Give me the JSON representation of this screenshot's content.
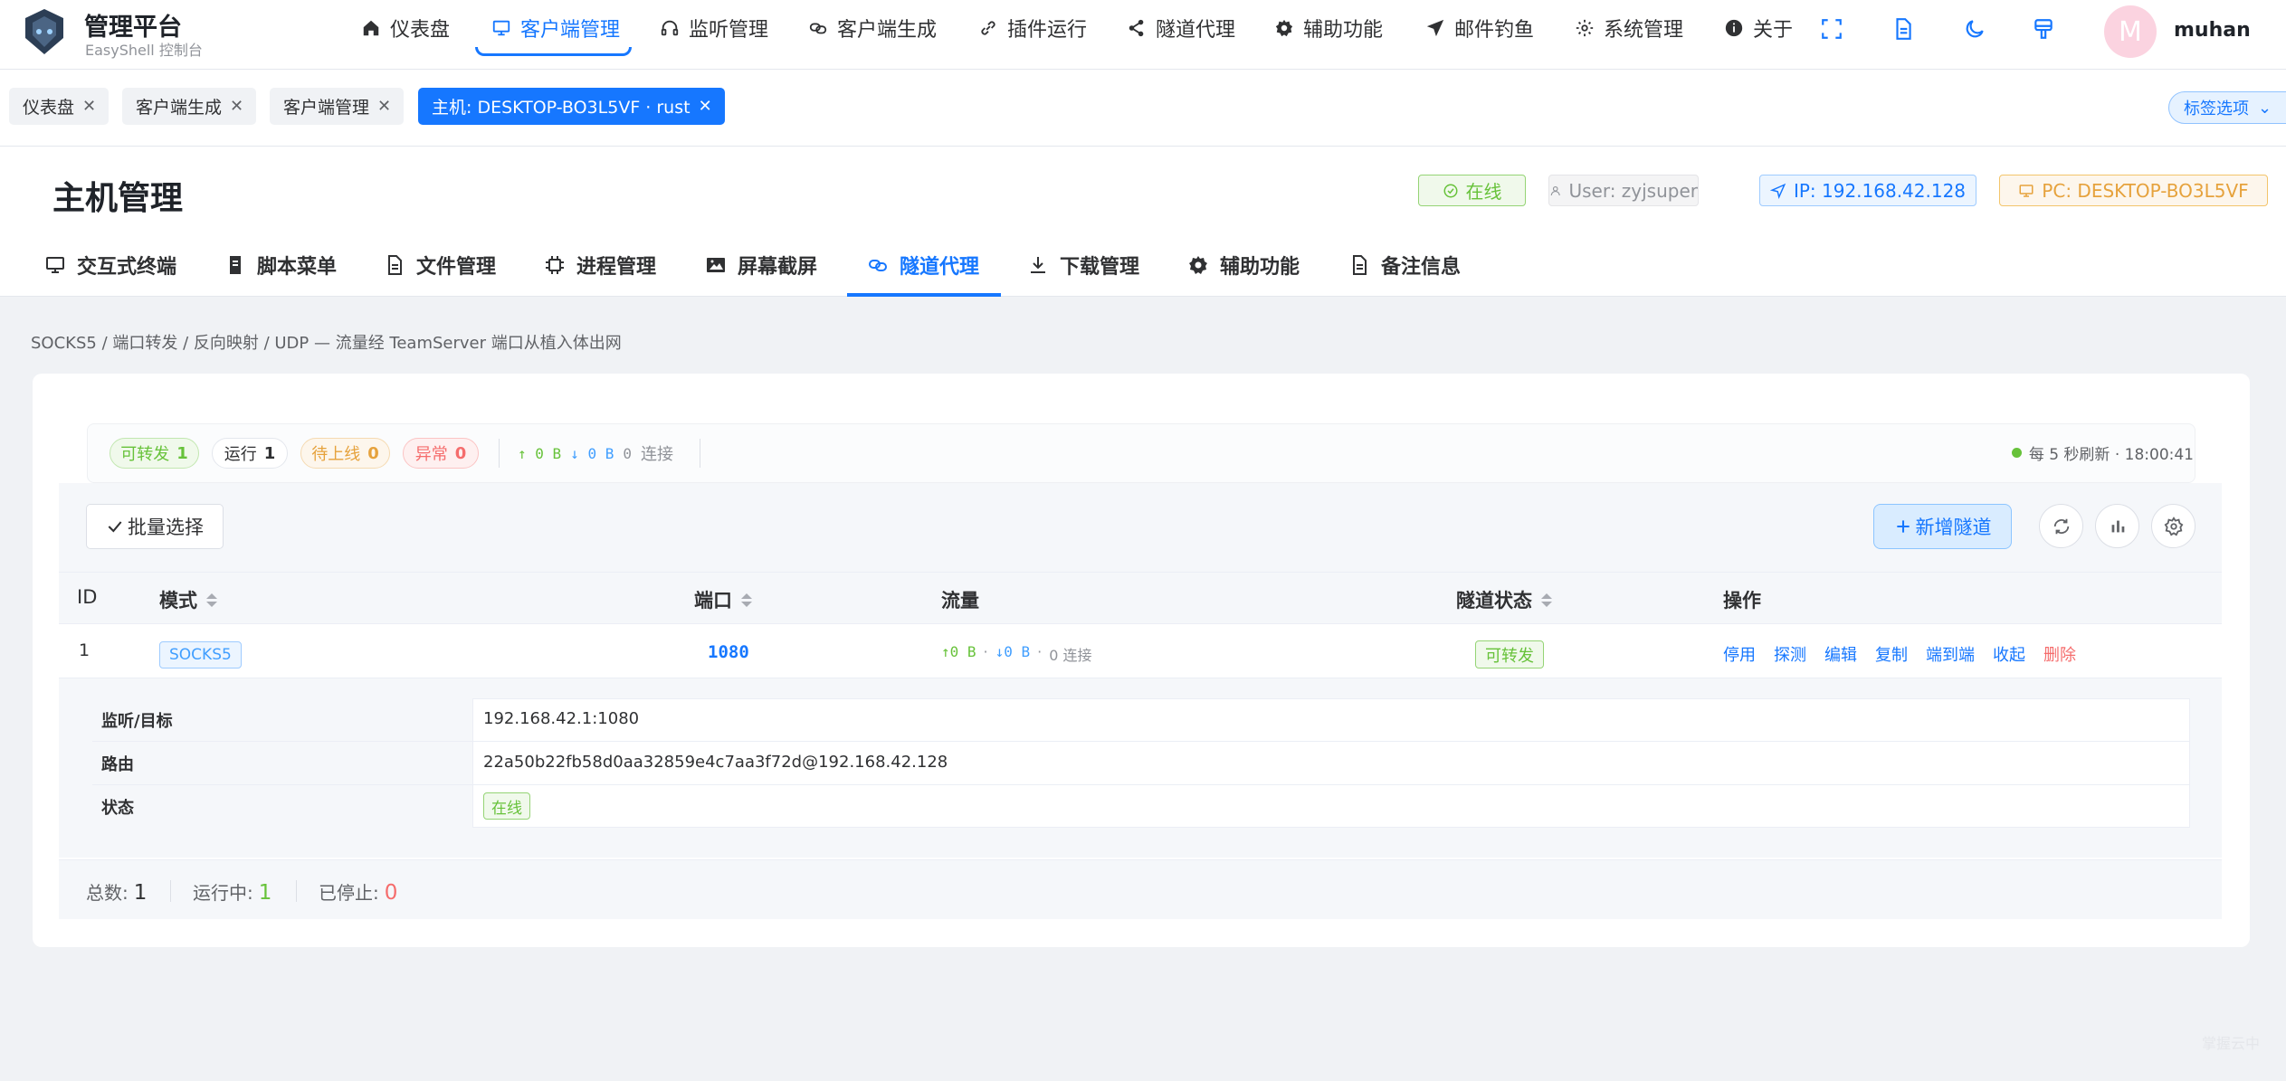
{
  "brand": {
    "title": "管理平台",
    "subtitle": "EasyShell 控制台"
  },
  "nav": [
    {
      "label": "仪表盘",
      "icon": "home-icon"
    },
    {
      "label": "客户端管理",
      "icon": "monitor-icon",
      "active": true
    },
    {
      "label": "监听管理",
      "icon": "headset-icon"
    },
    {
      "label": "客户端生成",
      "icon": "link-chain-icon"
    },
    {
      "label": "插件运行",
      "icon": "link-icon"
    },
    {
      "label": "隧道代理",
      "icon": "share-icon"
    },
    {
      "label": "辅助功能",
      "icon": "gear-icon"
    },
    {
      "label": "邮件钓鱼",
      "icon": "paper-plane-icon"
    },
    {
      "label": "系统管理",
      "icon": "settings-icon"
    },
    {
      "label": "关于",
      "icon": "info-icon"
    }
  ],
  "user": {
    "avatar_letter": "M",
    "name": "muhan"
  },
  "tags": [
    {
      "label": "仪表盘"
    },
    {
      "label": "客户端生成"
    },
    {
      "label": "客户端管理"
    },
    {
      "label": "主机: DESKTOP-BO3L5VF · rust",
      "active": true
    }
  ],
  "tag_options": "标签选项",
  "page": {
    "title": "主机管理",
    "badges": {
      "online": "在线",
      "user": "User: zyjsuper",
      "ip": "IP: 192.168.42.128",
      "pc": "PC: DESKTOP-BO3L5VF"
    }
  },
  "subtabs": [
    {
      "label": "交互式终端",
      "icon": "monitor-icon"
    },
    {
      "label": "脚本菜单",
      "icon": "script-icon"
    },
    {
      "label": "文件管理",
      "icon": "file-icon"
    },
    {
      "label": "进程管理",
      "icon": "cpu-icon"
    },
    {
      "label": "屏幕截屏",
      "icon": "image-icon"
    },
    {
      "label": "隧道代理",
      "icon": "link-chain-icon",
      "active": true
    },
    {
      "label": "下载管理",
      "icon": "download-icon"
    },
    {
      "label": "辅助功能",
      "icon": "gear-icon"
    },
    {
      "label": "备注信息",
      "icon": "document-icon"
    }
  ],
  "breadcrumb": "SOCKS5 / 端口转发 / 反向映射 / UDP — 流量经 TeamServer 端口从植入体出网",
  "stats": {
    "forwardable_label": "可转发",
    "forwardable": "1",
    "running_label": "运行",
    "running": "1",
    "pending_label": "待上线",
    "pending": "0",
    "error_label": "异常",
    "error": "0",
    "up": "↑ 0 B",
    "down": "↓ 0 B",
    "conn_num": "0",
    "conn_label": "连接",
    "refresh_text": "每 5 秒刷新 · 18:00:41"
  },
  "toolbar": {
    "batch_label": "批量选择",
    "add_label": "新增隧道"
  },
  "table": {
    "headers": {
      "id": "ID",
      "mode": "模式",
      "port": "端口",
      "traffic": "流量",
      "status": "隧道状态",
      "ops": "操作"
    },
    "rows": [
      {
        "id": "1",
        "mode": "SOCKS5",
        "port": "1080",
        "traffic_up": "↑0 B",
        "traffic_down": "↓0 B",
        "traffic_conn": "0 连接",
        "status": "可转发",
        "ops": [
          "停用",
          "探测",
          "编辑",
          "复制",
          "端到端",
          "收起",
          "删除"
        ]
      }
    ]
  },
  "detail": [
    {
      "key": "监听/目标",
      "value": "192.168.42.1:1080"
    },
    {
      "key": "路由",
      "value": "22a50b22fb58d0aa32859e4c7aa3f72d@192.168.42.128"
    },
    {
      "key": "状态",
      "value": "在线"
    }
  ],
  "footer": {
    "total_label": "总数:",
    "total": "1",
    "running_label": "运行中:",
    "running": "1",
    "stopped_label": "已停止:",
    "stopped": "0"
  },
  "watermark": "掌握云中",
  "colors": {
    "primary": "#1677ff",
    "success": "#67c23a",
    "warning": "#e6a23c",
    "danger": "#f56c6c"
  }
}
